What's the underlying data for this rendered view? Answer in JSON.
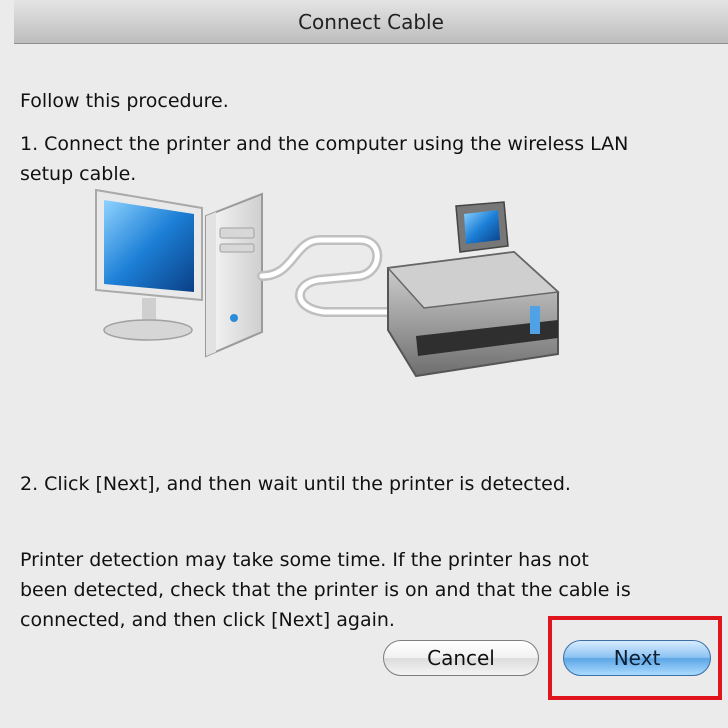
{
  "dialog": {
    "title": "Connect Cable",
    "intro": "Follow this procedure.",
    "step1_line1": "1. Connect the printer and the computer using the wireless LAN",
    "step1_line2": "setup cable.",
    "step2": "2. Click [Next], and then wait until the printer is detected.",
    "note_line1": "Printer detection may take some time. If the printer has not",
    "note_line2": "been detected, check that the printer is on and that the cable is",
    "note_line3": "connected, and then click [Next] again."
  },
  "buttons": {
    "cancel_label": "Cancel",
    "next_label": "Next"
  },
  "illustration": {
    "icons": [
      "monitor-icon",
      "computer-tower-icon",
      "lan-cable-icon",
      "printer-icon"
    ]
  },
  "colors": {
    "highlight": "#e0141d",
    "next_button": "#5ea6e6",
    "background": "#ebebeb"
  }
}
